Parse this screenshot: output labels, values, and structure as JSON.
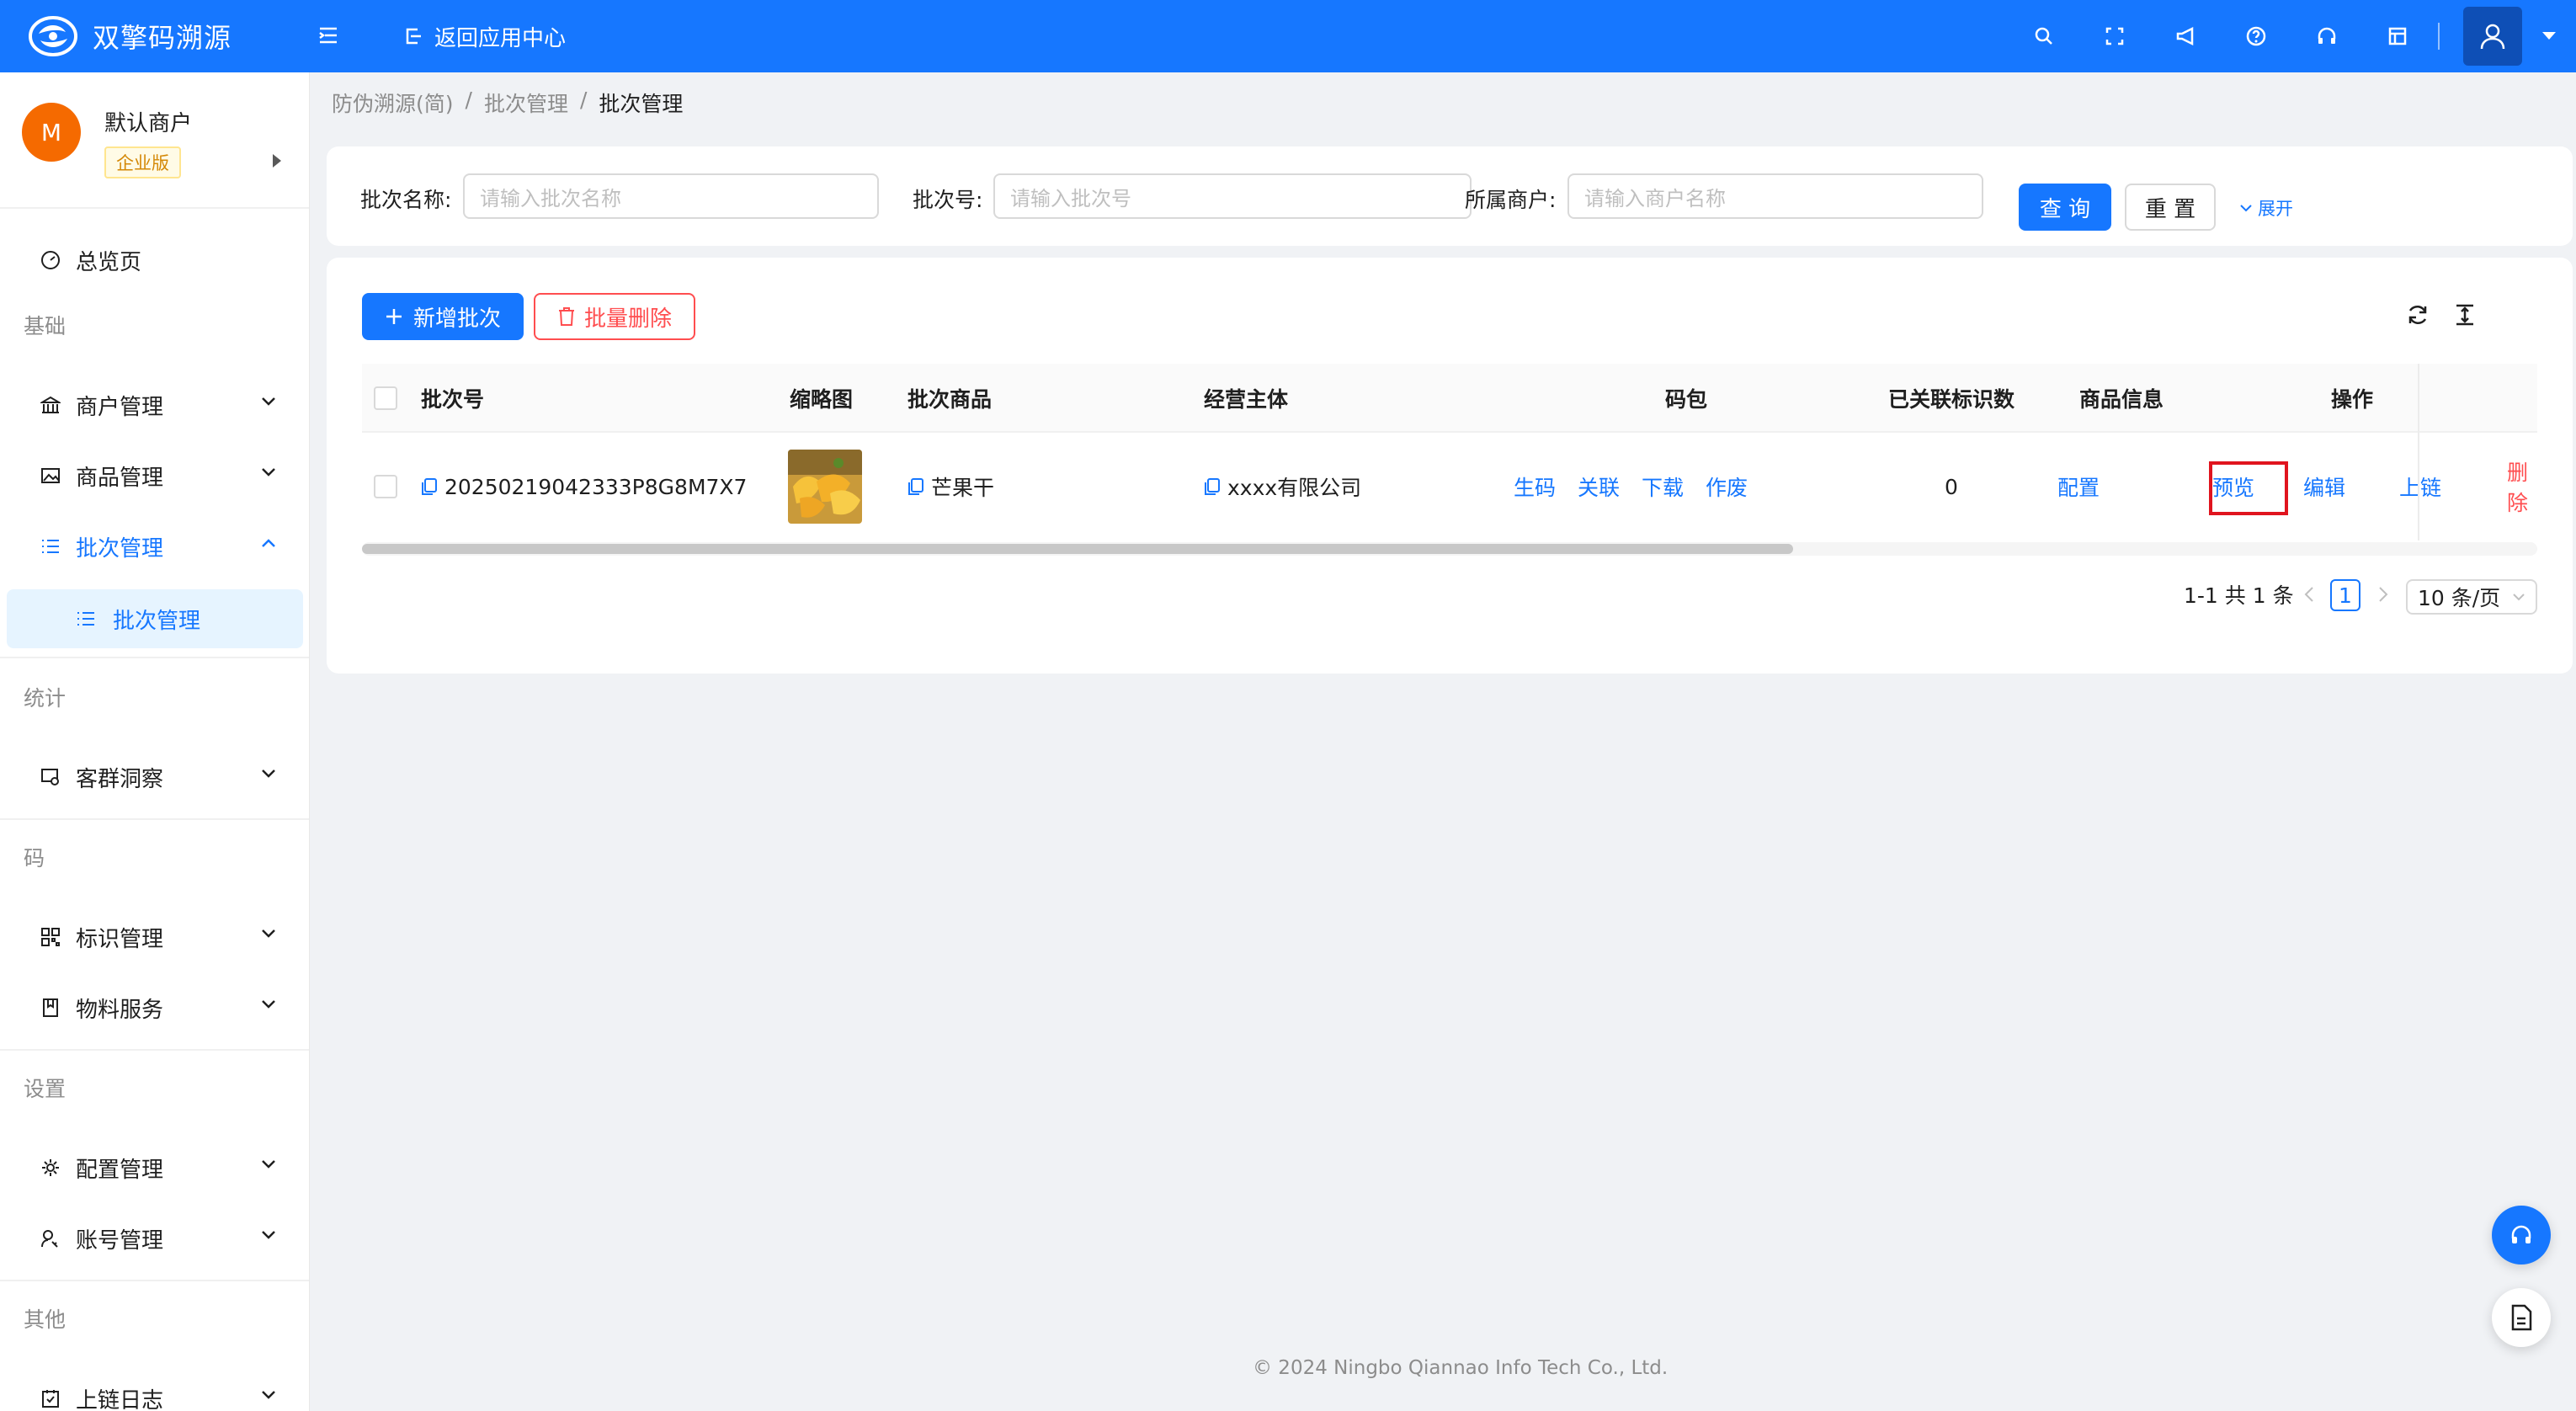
{
  "header": {
    "app_name": "双擎码溯源",
    "back_label": "返回应用中心",
    "tools": [
      "search-icon",
      "fullscreen-icon",
      "megaphone-icon",
      "help-icon",
      "headset-icon",
      "layout-icon"
    ],
    "accent": "#1677ff"
  },
  "sidebar": {
    "merchant_initial": "M",
    "merchant_name": "默认商户",
    "merchant_badge": "企业版",
    "overview": "总览页",
    "group_basic": "基础",
    "merchant_mgmt": "商户管理",
    "product_mgmt": "商品管理",
    "batch_mgmt": "批次管理",
    "batch_sub": "批次管理",
    "group_stats": "统计",
    "customer_insight": "客群洞察",
    "group_code": "码",
    "tag_mgmt": "标识管理",
    "material": "物料服务",
    "group_settings": "设置",
    "config_mgmt": "配置管理",
    "account_mgmt": "账号管理",
    "group_other": "其他",
    "chain_log": "上链日志"
  },
  "breadcrumb": [
    "防伪溯源(简)",
    "批次管理",
    "批次管理"
  ],
  "search": {
    "batch_name_label": "批次名称:",
    "batch_name_placeholder": "请输入批次名称",
    "batch_no_label": "批次号:",
    "batch_no_placeholder": "请输入批次号",
    "merchant_label": "所属商户:",
    "merchant_placeholder": "请输入商户名称",
    "query": "查 询",
    "reset": "重 置",
    "expand": "展开"
  },
  "toolbar": {
    "add": "新增批次",
    "batch_delete": "批量删除"
  },
  "table": {
    "headers": [
      "批次号",
      "缩略图",
      "批次商品",
      "经营主体",
      "码包",
      "已关联标识数",
      "商品信息",
      "操作"
    ],
    "row": {
      "batch_no": "20250219042333P8G8M7X7",
      "product": "芒果干",
      "entity": "xxxx有限公司",
      "code_actions": [
        "生码",
        "关联",
        "下载",
        "作废"
      ],
      "linked_count": "0",
      "product_info": "配置",
      "ops": [
        "预览",
        "编辑",
        "上链",
        "删除"
      ]
    }
  },
  "pagination": {
    "summary": "1-1 共 1 条",
    "current": "1",
    "page_size": "10 条/页"
  },
  "footer": "© 2024 Ningbo Qiannao Info Tech Co., Ltd."
}
